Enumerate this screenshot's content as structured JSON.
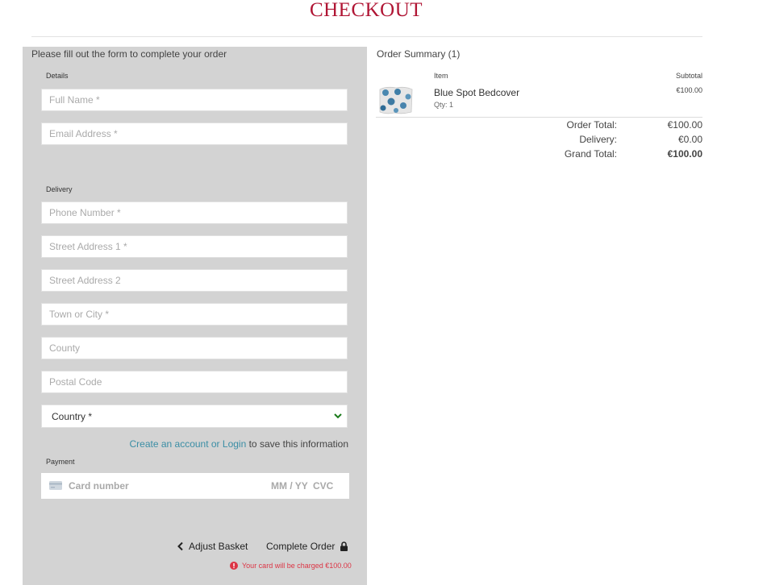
{
  "page": {
    "title": "CHECKOUT",
    "accent_color": "#b01534"
  },
  "form": {
    "intro": "Please fill out the form to complete your order",
    "details_label": "Details",
    "full_name_placeholder": "Full Name *",
    "email_placeholder": "Email Address *",
    "delivery_label": "Delivery",
    "phone_placeholder": "Phone Number *",
    "street1_placeholder": "Street Address 1 *",
    "street2_placeholder": "Street Address 2",
    "town_placeholder": "Town or City *",
    "county_placeholder": "County",
    "postcode_placeholder": "Postal Code",
    "country_value": "Country *",
    "create_account_link": "Create an account",
    "or_text": " or ",
    "login_link": "Login",
    "save_info_text": " to save this information",
    "payment_label": "Payment",
    "card_number_placeholder": "Card number",
    "card_expiry_placeholder": "MM / YY",
    "card_cvc_placeholder": "CVC",
    "adjust_basket_label": "Adjust Basket",
    "complete_order_label": "Complete Order",
    "charge_note": "Your card will be charged €100.00"
  },
  "summary": {
    "title": "Order Summary (1)",
    "col_item": "Item",
    "col_subtotal": "Subtotal",
    "items": [
      {
        "name": "Blue Spot Bedcover",
        "qty": "Qty: 1",
        "price": "€100.00"
      }
    ],
    "order_total_label": "Order Total:",
    "order_total_value": "€100.00",
    "delivery_label": "Delivery:",
    "delivery_value": "€0.00",
    "grand_total_label": "Grand Total:",
    "grand_total_value": "€100.00"
  },
  "icons": {
    "select_chevron": "chevron-down-icon",
    "card": "credit-card-icon",
    "back": "chevron-left-icon",
    "lock": "lock-icon",
    "alert": "alert-circle-icon"
  }
}
